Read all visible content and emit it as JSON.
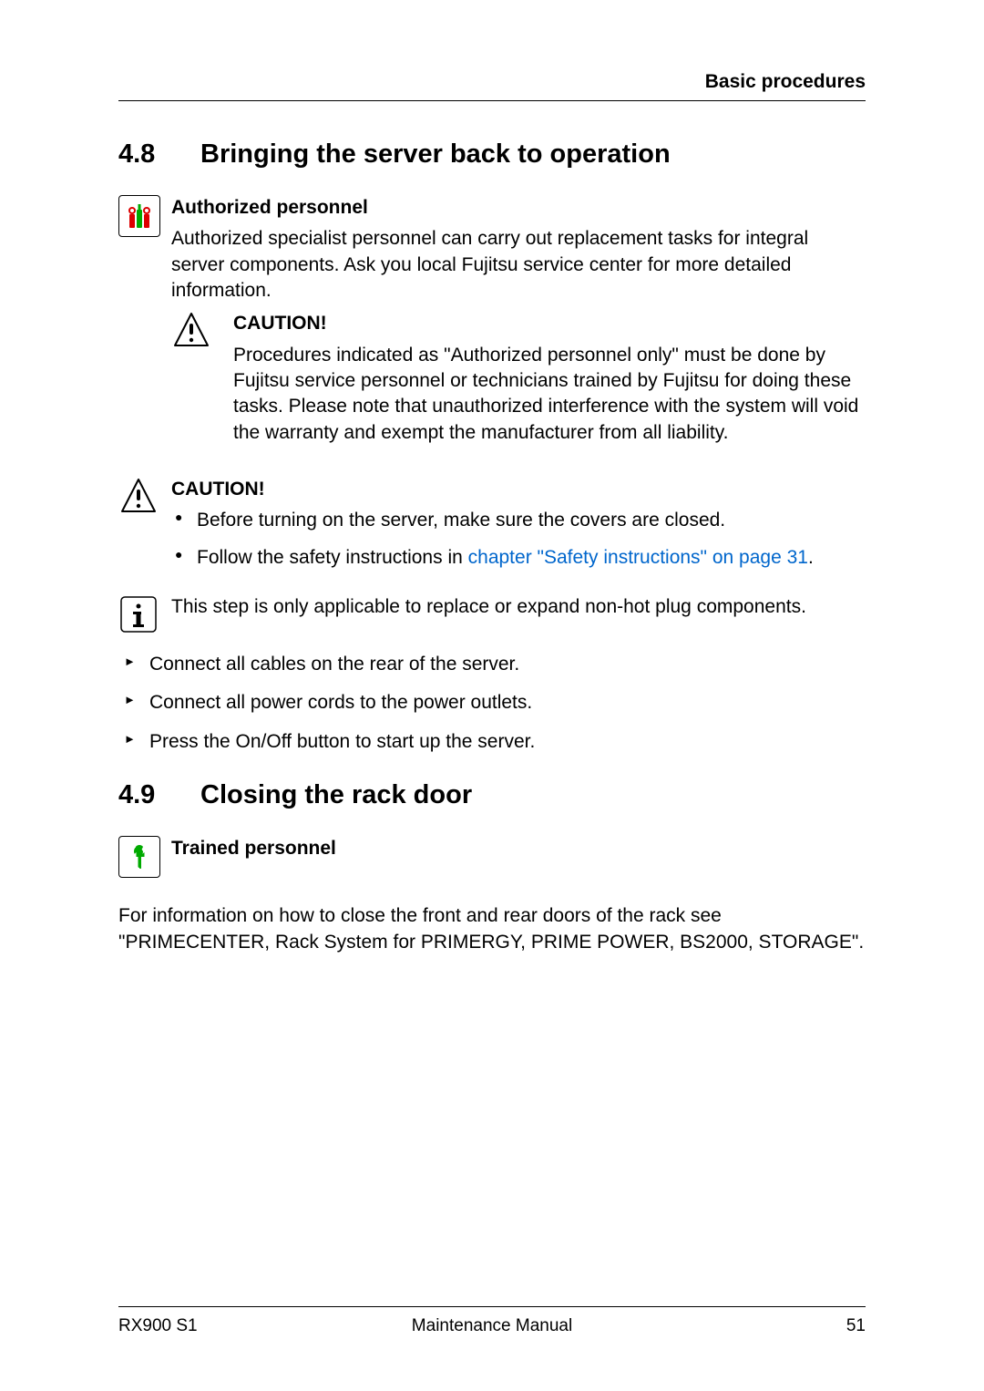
{
  "header": {
    "title": "Basic procedures"
  },
  "sections": {
    "s48": {
      "num": "4.8",
      "title": "Bringing the server back to operation",
      "auth": {
        "heading": "Authorized personnel",
        "text": "Authorized specialist personnel can carry out replacement tasks for integral server components. Ask you local Fujitsu service center for more detailed information.",
        "caution_label": "CAUTION!",
        "caution_text": "Procedures indicated as \"Authorized personnel only\" must be done by Fujitsu service personnel or technicians trained by Fujitsu for doing these tasks. Please note that unauthorized interference with the system will void the warranty and exempt the manufacturer from all liability."
      },
      "caution2": {
        "label": "CAUTION!",
        "bullet1": "Before turning on the server, make sure the covers are closed.",
        "bullet2_pre": "Follow the safety instructions in ",
        "bullet2_link": "chapter \"Safety instructions\" on page 31",
        "bullet2_post": "."
      },
      "info": "This step is only applicable to replace or expand non-hot plug components.",
      "steps": {
        "s1": "Connect all cables on the rear of the server.",
        "s2": "Connect all power cords to the power outlets.",
        "s3": "Press the On/Off button to start up the server."
      }
    },
    "s49": {
      "num": "4.9",
      "title": "Closing the rack door",
      "trained": {
        "heading": "Trained personnel"
      },
      "text": "For information on how to close the front and rear doors of the rack see \"PRIMECENTER, Rack System for PRIMERGY, PRIME POWER, BS2000, STORAGE\"."
    }
  },
  "footer": {
    "left": "RX900 S1",
    "center": "Maintenance Manual",
    "right": "51"
  }
}
